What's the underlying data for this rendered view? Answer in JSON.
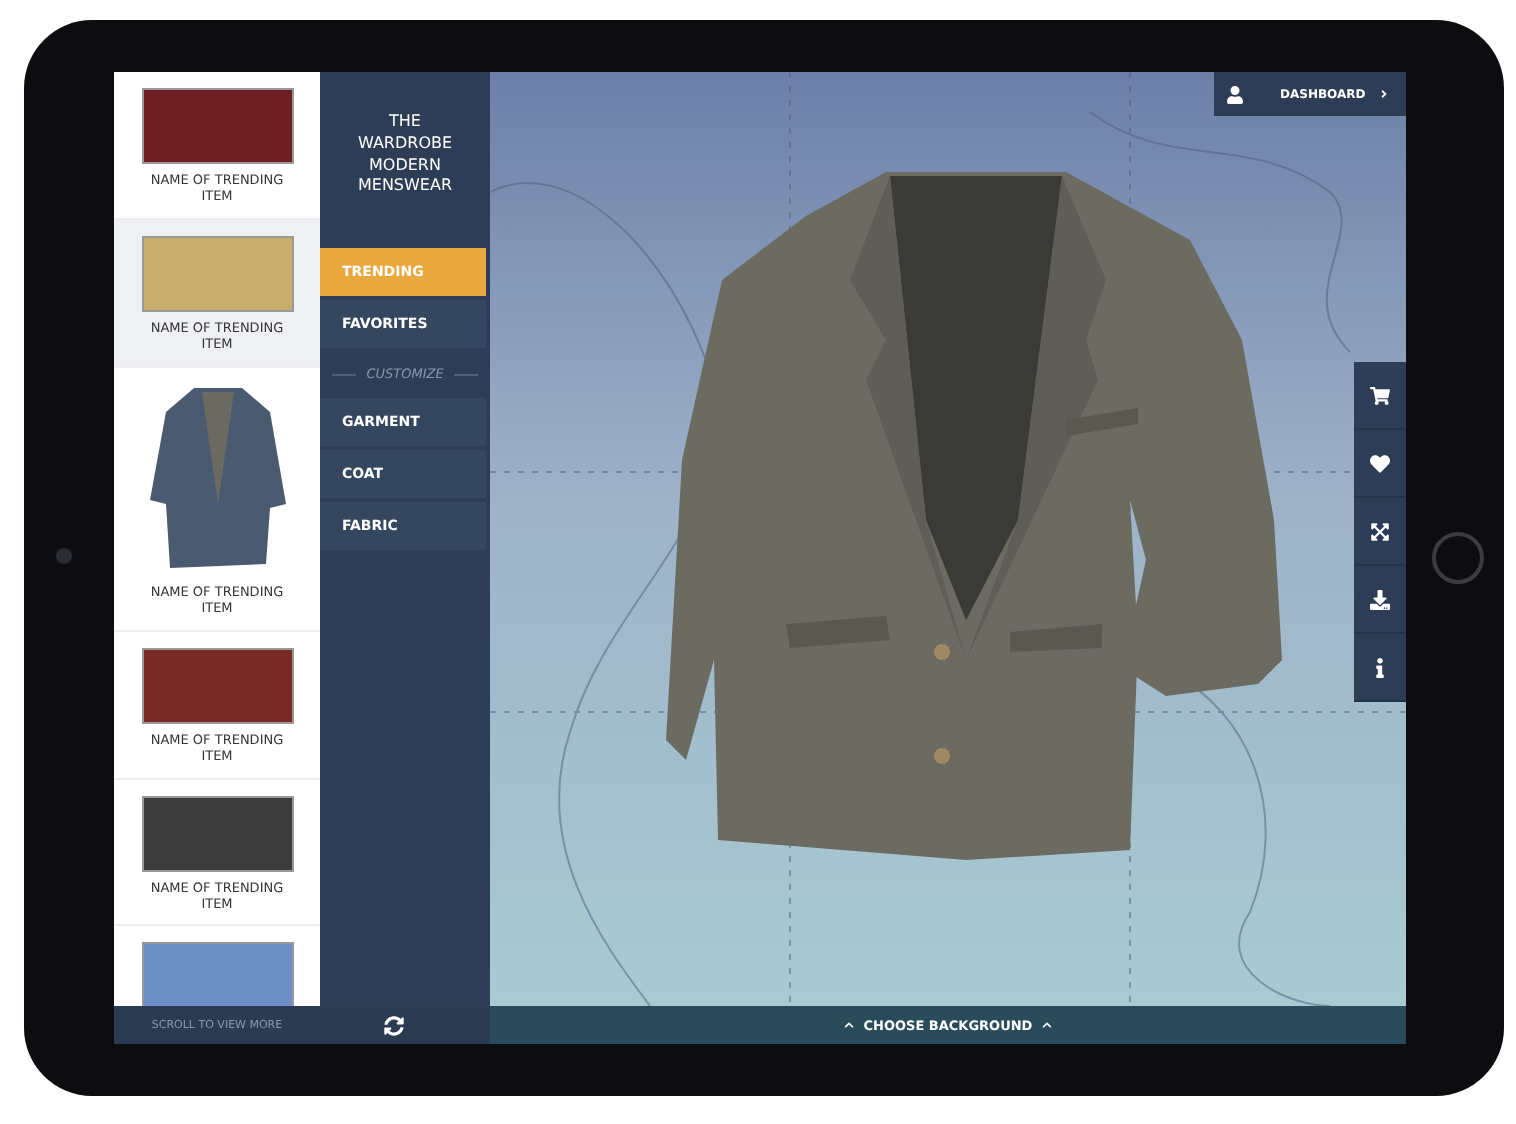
{
  "trending_items": [
    {
      "kind": "swatch",
      "color": "#6e1f24",
      "label": "NAME OF TRENDING ITEM",
      "selected": false
    },
    {
      "kind": "swatch",
      "color": "#c8ad6e",
      "label": "NAME OF TRENDING ITEM",
      "selected": true
    },
    {
      "kind": "jacket",
      "color": "#4a5a70",
      "label": "NAME OF TRENDING ITEM",
      "selected": false
    },
    {
      "kind": "swatch",
      "color": "#7a2a26",
      "label": "NAME OF TRENDING ITEM",
      "selected": false
    },
    {
      "kind": "swatch",
      "color": "#3c3c3c",
      "label": "NAME OF TRENDING ITEM",
      "selected": false
    },
    {
      "kind": "swatch",
      "color": "#6f8fc8",
      "selected": false
    }
  ],
  "brand": "THE WARDROBE MODERN MENSWEAR",
  "nav": [
    {
      "kind": "item",
      "label": "TRENDING",
      "selected": true
    },
    {
      "kind": "item",
      "label": "FAVORITES",
      "selected": false
    },
    {
      "kind": "heading",
      "label": "CUSTOMIZE"
    },
    {
      "kind": "item",
      "label": "GARMENT",
      "selected": false
    },
    {
      "kind": "item",
      "label": "COAT",
      "selected": false
    },
    {
      "kind": "item",
      "label": "FABRIC",
      "selected": false
    }
  ],
  "scroll_hint": "SCROLL TO VIEW MORE",
  "dashboard": "DASHBOARD",
  "choose_background": "CHOOSE BACKGROUND"
}
